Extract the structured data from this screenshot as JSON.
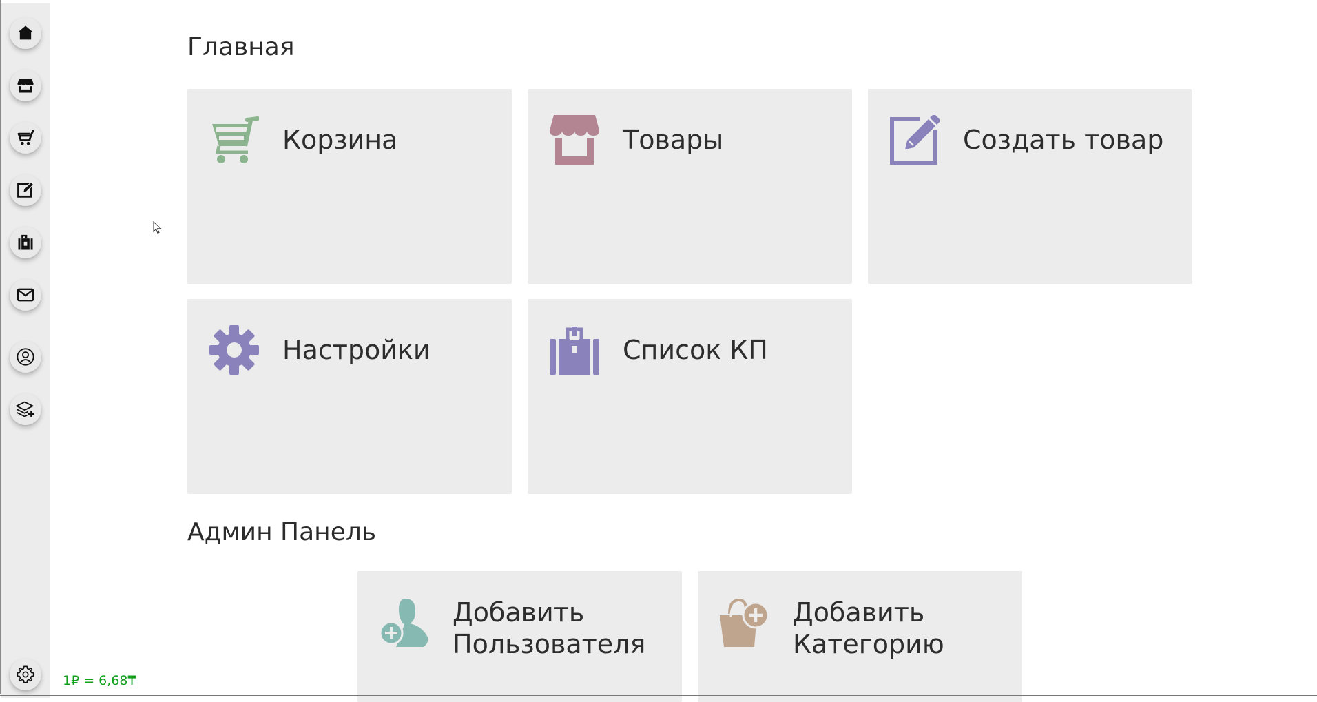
{
  "sidebar": {
    "items": [
      {
        "icon": "home-icon"
      },
      {
        "icon": "shop-icon"
      },
      {
        "icon": "cart-icon"
      },
      {
        "icon": "edit-icon"
      },
      {
        "icon": "luggage-icon"
      },
      {
        "icon": "mail-icon"
      },
      {
        "icon": "user-circle-icon"
      },
      {
        "icon": "layers-plus-icon"
      }
    ],
    "bottom_item": {
      "icon": "gear-icon"
    }
  },
  "exchange_rate": "1₽ = 6,68₸",
  "main": {
    "title": "Главная",
    "cards": [
      {
        "label": "Корзина",
        "icon": "cart-icon",
        "color": "#8cb58f"
      },
      {
        "label": "Товары",
        "icon": "shop-icon",
        "color": "#b38593"
      },
      {
        "label": "Создать товар",
        "icon": "edit-icon",
        "color": "#8a83bb"
      },
      {
        "label": "Настройки",
        "icon": "gear-icon",
        "color": "#8a83bb"
      },
      {
        "label": "Список КП",
        "icon": "luggage-icon",
        "color": "#8a83bb"
      }
    ]
  },
  "admin": {
    "title": "Админ Панель",
    "cards": [
      {
        "label_line1": "Добавить",
        "label_line2": "Пользователя",
        "icon": "add-user-icon",
        "color": "#86b9b2"
      },
      {
        "label_line1": "Добавить",
        "label_line2": "Категорию",
        "icon": "add-category-icon",
        "color": "#c0a58e"
      }
    ]
  },
  "colors": {
    "sidebar_bg": "#ececec",
    "card_bg": "#ececec",
    "rate_text": "#12a01c"
  }
}
